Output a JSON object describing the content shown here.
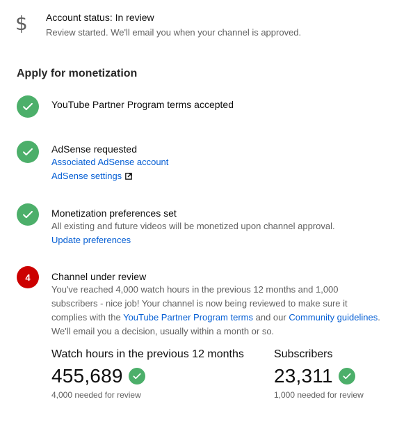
{
  "status": {
    "icon": "dollar-icon",
    "title": "Account status: In review",
    "subtitle": "Review started. We'll email you when your channel is approved."
  },
  "section_title": "Apply for monetization",
  "steps": [
    {
      "state": "complete",
      "title": "YouTube Partner Program terms accepted"
    },
    {
      "state": "complete",
      "title": "AdSense requested",
      "link1": "Associated AdSense account",
      "link2": "AdSense settings"
    },
    {
      "state": "complete",
      "title": "Monetization preferences set",
      "description": "All existing and future videos will be monetized upon channel approval.",
      "link1": "Update preferences"
    },
    {
      "state": "in-review",
      "number": "4",
      "title": "Channel under review",
      "description_line1": "You've reached 4,000 watch hours in the previous 12 months and 1,000",
      "description_line2": "subscribers - nice job! Your channel is now being reviewed to make sure it",
      "description_line3_a": "complies with the ",
      "description_line3_link1": "YouTube Partner Program terms",
      "description_line3_b": " and our ",
      "description_line3_link2": "Community guidelines",
      "description_line3_c": ".",
      "description_line4": "We'll email you a decision, usually within a month or so."
    }
  ],
  "metrics": [
    {
      "label": "Watch hours in the previous 12 months",
      "value": "455,689",
      "note": "4,000 needed for review"
    },
    {
      "label": "Subscribers",
      "value": "23,311",
      "note": "1,000 needed for review"
    }
  ],
  "colors": {
    "success": "#4caf6a",
    "alert": "#cc0000",
    "link": "#065fd4"
  }
}
